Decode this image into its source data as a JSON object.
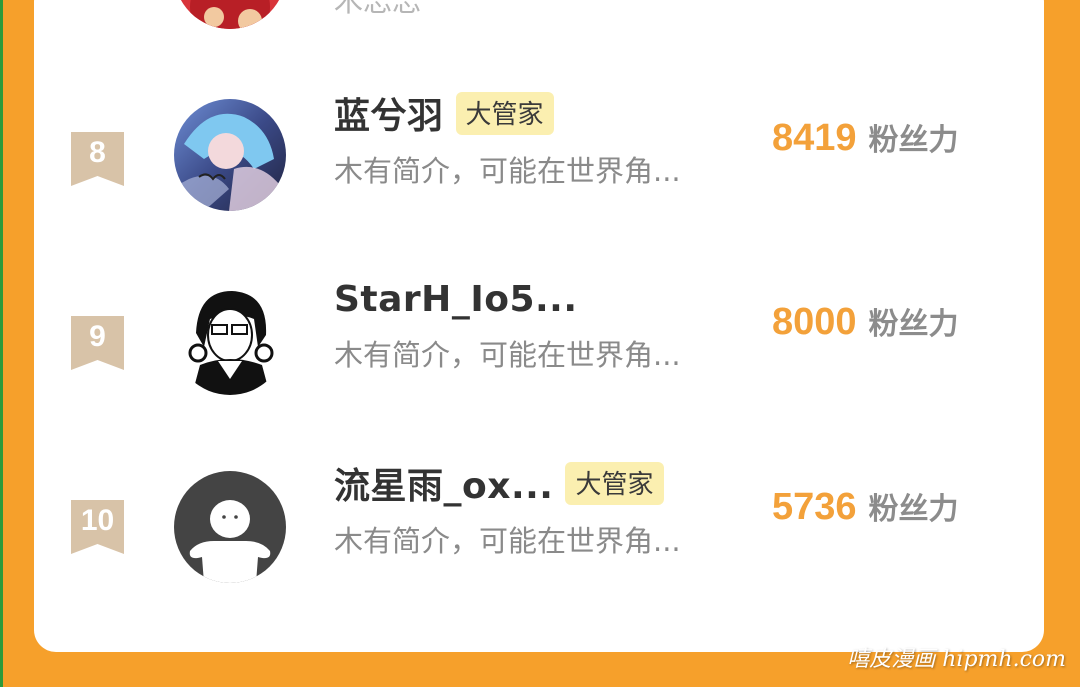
{
  "previous_entry": {
    "bio": "木忘忘"
  },
  "leaderboard": [
    {
      "rank": "8",
      "name": "蓝兮羽",
      "badge": "大管家",
      "bio": "木有简介，可能在世界角...",
      "score": "8419",
      "score_unit": "粉丝力",
      "avatar": "anime-girl-avatar"
    },
    {
      "rank": "9",
      "name": "StarH_Io5...",
      "badge": "",
      "bio": "木有简介，可能在世界角...",
      "score": "8000",
      "score_unit": "粉丝力",
      "avatar": "sketch-boy-avatar"
    },
    {
      "rank": "10",
      "name": "流星雨_ox...",
      "badge": "大管家",
      "bio": "木有简介，可能在世界角...",
      "score": "5736",
      "score_unit": "粉丝力",
      "avatar": "default-user-avatar"
    }
  ],
  "watermark": "嘻皮漫画 hipmh.com",
  "colors": {
    "page_background": "#f6a02b",
    "card_background": "#ffffff",
    "score": "#f3a13a",
    "rank_badge": "#d8c3a8",
    "role_badge": "#fbefb0"
  }
}
